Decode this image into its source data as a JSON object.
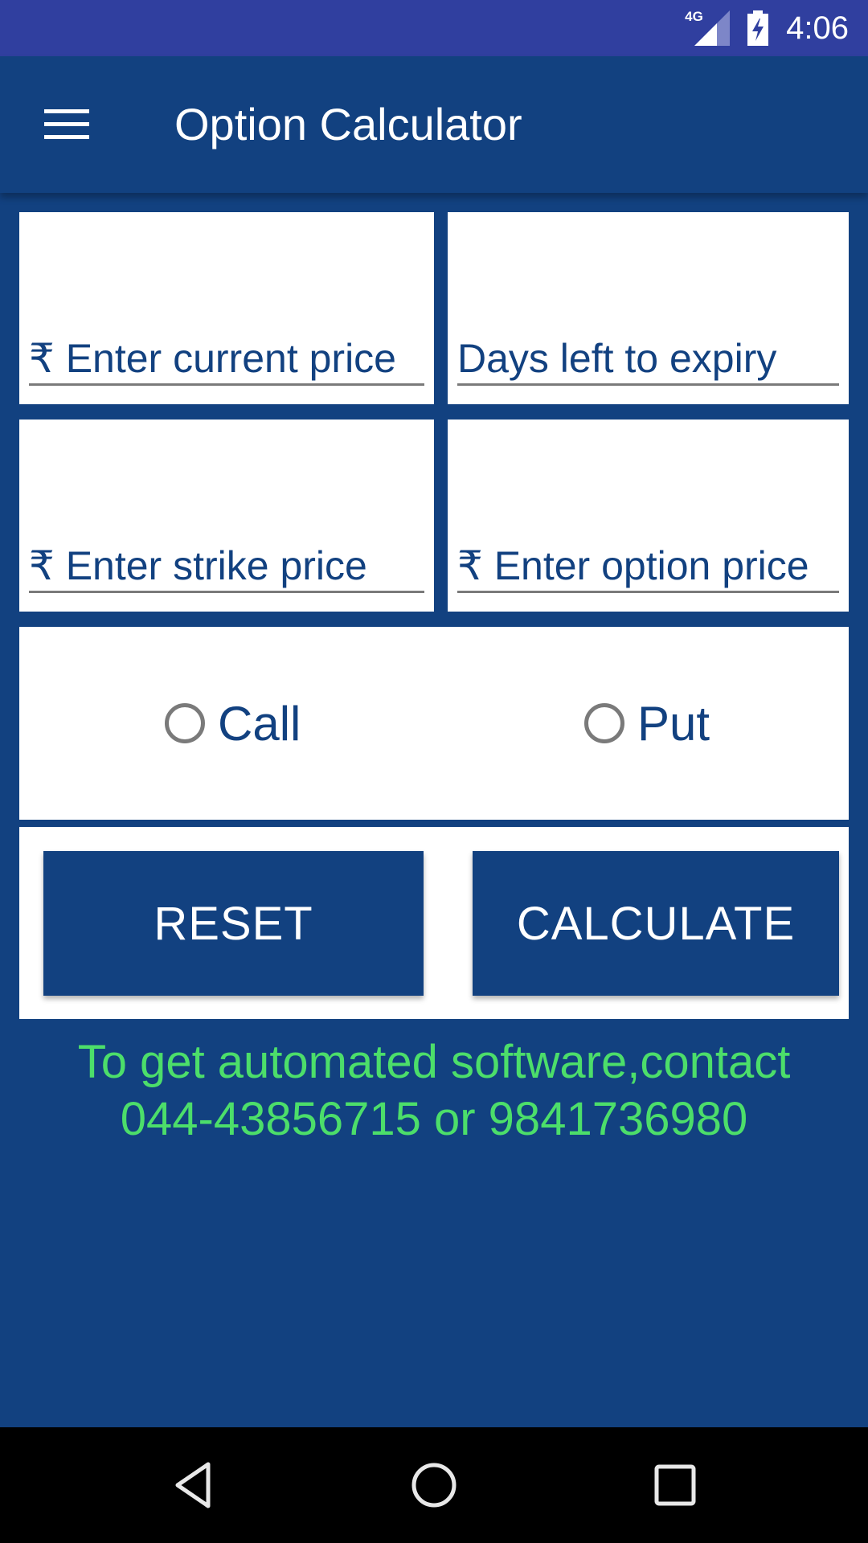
{
  "status_bar": {
    "network_label": "4G",
    "time": "4:06",
    "icons": [
      "signal-icon",
      "battery-charging-icon"
    ]
  },
  "toolbar": {
    "menu_icon": "hamburger-menu-icon",
    "title": "Option Calculator"
  },
  "form": {
    "current_price": {
      "placeholder": "₹ Enter current price",
      "value": ""
    },
    "days_to_expiry": {
      "placeholder": "Days left to expiry",
      "value": ""
    },
    "strike_price": {
      "placeholder": "₹ Enter strike price",
      "value": ""
    },
    "option_price": {
      "placeholder": "₹ Enter option price",
      "value": ""
    },
    "option_type": {
      "options": [
        {
          "label": "Call",
          "selected": false
        },
        {
          "label": "Put",
          "selected": false
        }
      ]
    }
  },
  "buttons": {
    "reset": "RESET",
    "calculate": "CALCULATE"
  },
  "promo": {
    "line1": "To get automated software,contact",
    "line2": "044-43856715 or 9841736980"
  },
  "colors": {
    "primary": "#124180",
    "status_bar": "#303f9f",
    "promo_text": "#4cde6a"
  },
  "nav_bar": {
    "icons": [
      "back-icon",
      "home-icon",
      "recents-icon"
    ]
  }
}
